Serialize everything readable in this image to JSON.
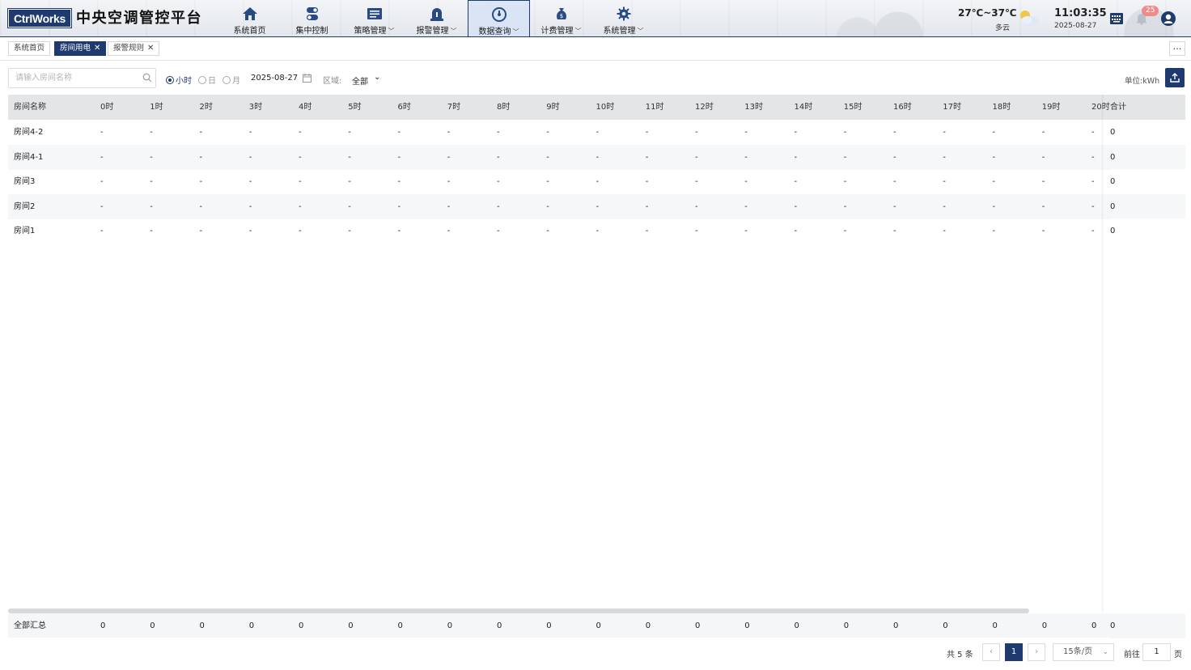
{
  "header": {
    "logo": "CtrlWorks",
    "title": "中央空调管控平台",
    "nav": [
      {
        "label": "系统首页",
        "icon": "home-icon",
        "has_menu": false,
        "active": false
      },
      {
        "label": "集中控制",
        "icon": "toggle-control-icon",
        "has_menu": false,
        "active": false
      },
      {
        "label": "策略管理",
        "icon": "strategy-icon",
        "has_menu": true,
        "active": false
      },
      {
        "label": "报警管理",
        "icon": "alarm-icon",
        "has_menu": true,
        "active": false
      },
      {
        "label": "数据查询",
        "icon": "gauge-icon",
        "has_menu": true,
        "active": true
      },
      {
        "label": "计费管理",
        "icon": "money-bag-icon",
        "has_menu": true,
        "active": false
      },
      {
        "label": "系统管理",
        "icon": "gear-icon",
        "has_menu": true,
        "active": false
      }
    ],
    "weather": {
      "temp": "27℃~37℃",
      "desc": "多云",
      "icon": "partly-cloudy-icon"
    },
    "clock": {
      "time": "11:03:35",
      "date": "2025-08-27"
    },
    "notification_count": "25"
  },
  "tabs": [
    {
      "label": "系统首页",
      "active": false,
      "closable": false
    },
    {
      "label": "房间用电",
      "active": true,
      "closable": true
    },
    {
      "label": "报警规则",
      "active": false,
      "closable": true
    }
  ],
  "toolbar": {
    "search_placeholder": "请输入房间名称",
    "granularity": [
      {
        "label": "小时",
        "selected": true
      },
      {
        "label": "日",
        "selected": false
      },
      {
        "label": "月",
        "selected": false
      }
    ],
    "date": "2025-08-27",
    "region_label": "区域:",
    "region_value": "全部",
    "unit": "单位:kWh"
  },
  "table": {
    "name_header": "房间名称",
    "hour_headers": [
      "0时",
      "1时",
      "2时",
      "3时",
      "4时",
      "5时",
      "6时",
      "7时",
      "8时",
      "9时",
      "10时",
      "11时",
      "12时",
      "13时",
      "14时",
      "15时",
      "16时",
      "17时",
      "18时",
      "19时",
      "20时"
    ],
    "total_header": "合计",
    "rows": [
      {
        "name": "房间4-2",
        "values": [
          "-",
          "-",
          "-",
          "-",
          "-",
          "-",
          "-",
          "-",
          "-",
          "-",
          "-",
          "-",
          "-",
          "-",
          "-",
          "-",
          "-",
          "-",
          "-",
          "-",
          "-"
        ],
        "total": "0"
      },
      {
        "name": "房间4-1",
        "values": [
          "-",
          "-",
          "-",
          "-",
          "-",
          "-",
          "-",
          "-",
          "-",
          "-",
          "-",
          "-",
          "-",
          "-",
          "-",
          "-",
          "-",
          "-",
          "-",
          "-",
          "-"
        ],
        "total": "0"
      },
      {
        "name": "房间3",
        "values": [
          "-",
          "-",
          "-",
          "-",
          "-",
          "-",
          "-",
          "-",
          "-",
          "-",
          "-",
          "-",
          "-",
          "-",
          "-",
          "-",
          "-",
          "-",
          "-",
          "-",
          "-"
        ],
        "total": "0"
      },
      {
        "name": "房间2",
        "values": [
          "-",
          "-",
          "-",
          "-",
          "-",
          "-",
          "-",
          "-",
          "-",
          "-",
          "-",
          "-",
          "-",
          "-",
          "-",
          "-",
          "-",
          "-",
          "-",
          "-",
          "-"
        ],
        "total": "0"
      },
      {
        "name": "房间1",
        "values": [
          "-",
          "-",
          "-",
          "-",
          "-",
          "-",
          "-",
          "-",
          "-",
          "-",
          "-",
          "-",
          "-",
          "-",
          "-",
          "-",
          "-",
          "-",
          "-",
          "-",
          "-"
        ],
        "total": "0"
      }
    ],
    "summary": {
      "label": "全部汇总",
      "values": [
        "0",
        "0",
        "0",
        "0",
        "0",
        "0",
        "0",
        "0",
        "0",
        "0",
        "0",
        "0",
        "0",
        "0",
        "0",
        "0",
        "0",
        "0",
        "0",
        "0",
        "0"
      ],
      "total": "0"
    }
  },
  "pagination": {
    "total_text": "共 5 条",
    "current_page": "1",
    "page_size": "15条/页",
    "goto_label": "前往",
    "goto_value": "1",
    "page_unit": "页"
  },
  "colors": {
    "brand": "#1e3a6e",
    "header_row": "#e4e5e7",
    "badge": "#f08a8a"
  }
}
